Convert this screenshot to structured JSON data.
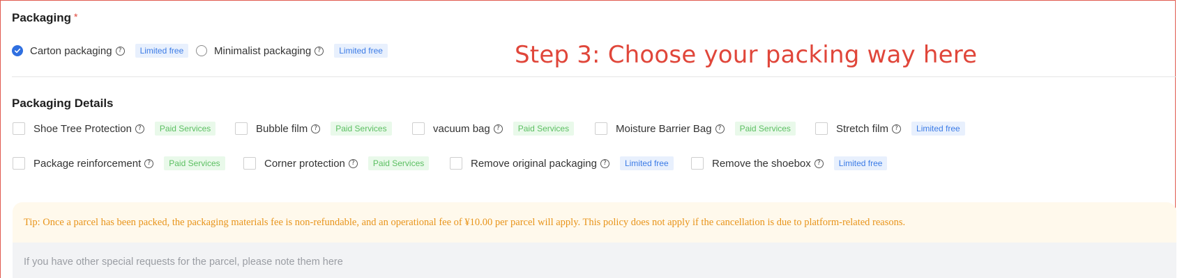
{
  "packaging": {
    "title": "Packaging",
    "required_mark": "*",
    "options": [
      {
        "label": "Carton packaging",
        "help": "?",
        "tag": "Limited free",
        "selected": true
      },
      {
        "label": "Minimalist packaging",
        "help": "?",
        "tag": "Limited free",
        "selected": false
      }
    ]
  },
  "annotation": "Step 3: Choose your packing way here",
  "details": {
    "title": "Packaging Details",
    "items": [
      {
        "label": "Shoe Tree Protection",
        "help": "?",
        "tag": "Paid Services",
        "checked": false
      },
      {
        "label": "Bubble film",
        "help": "?",
        "tag": "Paid Services",
        "checked": false
      },
      {
        "label": "vacuum bag",
        "help": "?",
        "tag": "Paid Services",
        "checked": false
      },
      {
        "label": "Moisture Barrier Bag",
        "help": "?",
        "tag": "Paid Services",
        "checked": false
      },
      {
        "label": "Stretch film",
        "help": "?",
        "tag": "Limited free",
        "checked": false
      },
      {
        "label": "Package reinforcement",
        "help": "?",
        "tag": "Paid Services",
        "checked": false
      },
      {
        "label": "Corner protection",
        "help": "?",
        "tag": "Paid Services",
        "checked": false
      },
      {
        "label": "Remove original packaging",
        "help": "?",
        "tag": "Limited free",
        "checked": false
      },
      {
        "label": "Remove the shoebox",
        "help": "?",
        "tag": "Limited free",
        "checked": false
      }
    ]
  },
  "tip": "Tip: Once a parcel has been packed, the packaging materials fee is non-refundable, and an operational fee of ¥10.00 per parcel will apply. This policy does not apply if the cancellation is due to platform-related reasons.",
  "notes": {
    "placeholder": "If you have other special requests for the parcel, please note them here"
  },
  "colors": {
    "accent_blue": "#2f6fe0",
    "annotation_red": "#e0463a",
    "free_tag_bg": "#e8f0fd",
    "paid_tag_bg": "#e9f9ea",
    "tip_text": "#e8941a"
  }
}
